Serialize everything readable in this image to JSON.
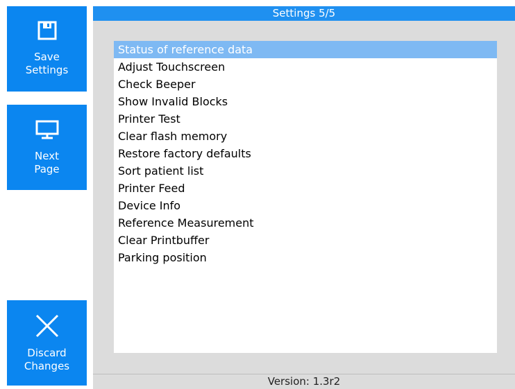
{
  "sidebar": {
    "save": {
      "line1": "Save",
      "line2": "Settings",
      "icon": "floppy-disk-icon"
    },
    "next": {
      "line1": "Next",
      "line2": "Page",
      "icon": "monitor-icon"
    },
    "discard": {
      "line1": "Discard",
      "line2": "Changes",
      "icon": "close-x-icon"
    }
  },
  "header": {
    "title": "Settings 5/5"
  },
  "settings_list": [
    "Status of reference data",
    "Adjust Touchscreen",
    "Check Beeper",
    "Show Invalid Blocks",
    "Printer Test",
    "Clear flash memory",
    "Restore factory defaults",
    "Sort patient list",
    "Printer Feed",
    "Device Info",
    "Reference Measurement",
    "Clear Printbuffer",
    "Parking position"
  ],
  "selected_index": 0,
  "footer": {
    "version": "Version: 1.3r2"
  },
  "colors": {
    "button_blue": "#0b86f0",
    "header_blue": "#1f90f0",
    "selection": "#7eb9f3",
    "panel_gray": "#dcdcdc"
  }
}
